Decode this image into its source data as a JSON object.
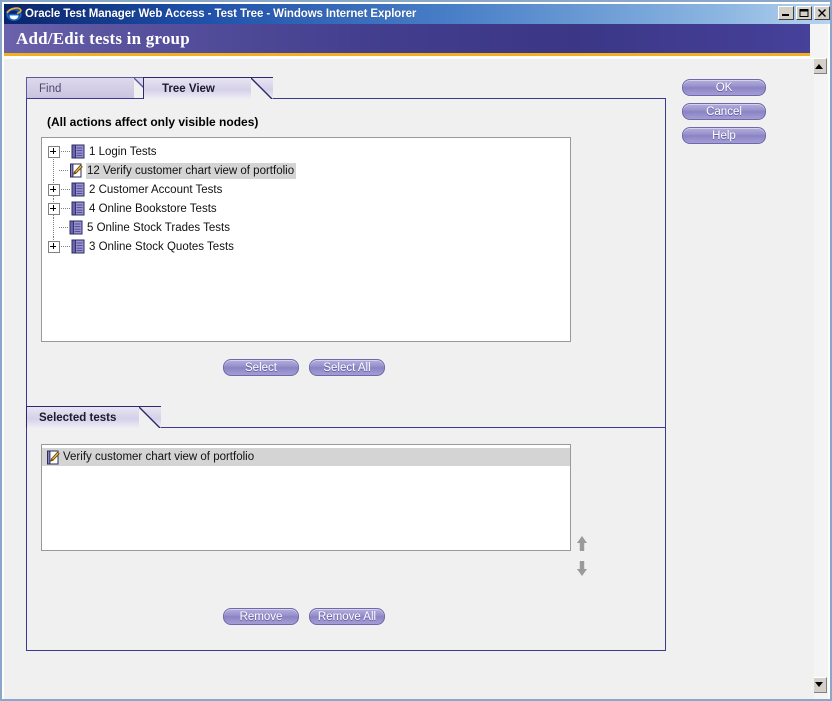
{
  "window": {
    "title": "Oracle Test Manager Web Access - Test Tree - Windows Internet Explorer",
    "icon": "ie-logo-icon",
    "controls": {
      "minimize": "minimize-button",
      "restore": "restore-button",
      "close": "close-button"
    }
  },
  "banner": {
    "title": "Add/Edit tests in group",
    "accent_color": "#f2b01e",
    "background_color": "#433e8e"
  },
  "tabs": [
    {
      "label": "Find",
      "active": false
    },
    {
      "label": "Tree View",
      "active": true
    }
  ],
  "tree_panel": {
    "hint": "(All actions affect only visible nodes)",
    "nodes": [
      {
        "expander": "plus",
        "icon": "test-folder-icon",
        "label": "1 Login Tests",
        "selected": false,
        "last": false
      },
      {
        "expander": "leaf",
        "icon": "test-document-icon",
        "label": "12 Verify customer chart view of portfolio",
        "selected": true,
        "last": false
      },
      {
        "expander": "plus",
        "icon": "test-folder-icon",
        "label": "2 Customer Account Tests",
        "selected": false,
        "last": false
      },
      {
        "expander": "plus",
        "icon": "test-folder-icon",
        "label": "4 Online Bookstore Tests",
        "selected": false,
        "last": false
      },
      {
        "expander": "leaf",
        "icon": "test-folder-icon",
        "label": "5 Online Stock Trades Tests",
        "selected": false,
        "last": false
      },
      {
        "expander": "plus",
        "icon": "test-folder-icon",
        "label": "3 Online Stock Quotes Tests",
        "selected": false,
        "last": true
      }
    ],
    "buttons": {
      "select": "Select",
      "select_all": "Select All"
    }
  },
  "selected_panel": {
    "tab_label": "Selected tests",
    "items": [
      {
        "icon": "test-document-icon",
        "label": "Verify customer chart view of portfolio",
        "selected": true
      }
    ],
    "reorder": {
      "up": "move-up-arrow",
      "down": "move-down-arrow"
    },
    "buttons": {
      "remove": "Remove",
      "remove_all": "Remove All"
    }
  },
  "dialog_buttons": {
    "ok": "OK",
    "cancel": "Cancel",
    "help": "Help"
  }
}
